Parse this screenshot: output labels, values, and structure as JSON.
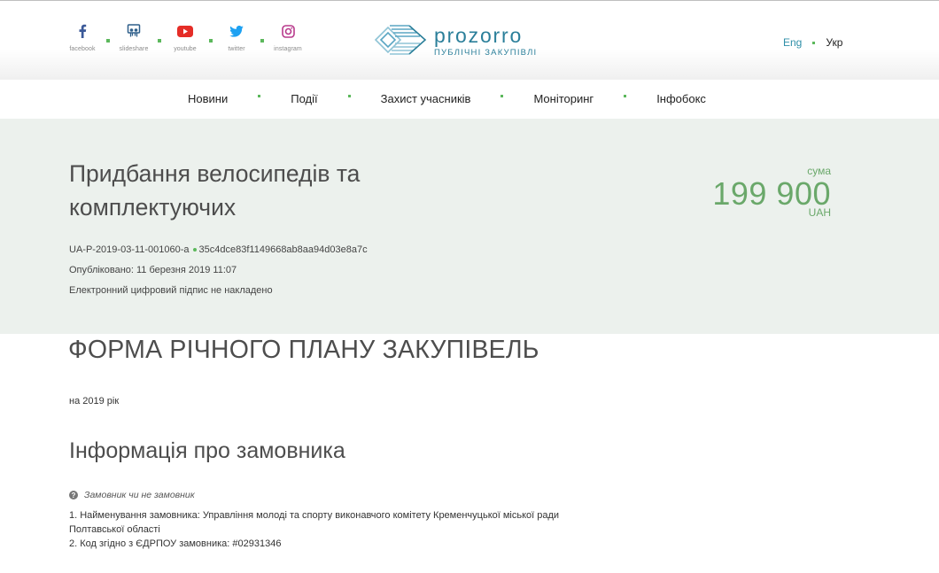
{
  "header": {
    "social": [
      {
        "icon": "facebook-icon",
        "label": "facebook",
        "color": "#3b5998"
      },
      {
        "icon": "slideshare-icon",
        "label": "slideshare",
        "color": "#2e5f8a"
      },
      {
        "icon": "youtube-icon",
        "label": "youtube",
        "color": "#e52d27"
      },
      {
        "icon": "twitter-icon",
        "label": "twitter",
        "color": "#1da1f2"
      },
      {
        "icon": "instagram-icon",
        "label": "instagram",
        "color": "#b83a8c"
      }
    ],
    "logo": {
      "name": "prozorro",
      "subtitle": "ПУБЛІЧНІ ЗАКУПІВЛІ"
    },
    "lang": {
      "en": "Eng",
      "uk": "Укр"
    }
  },
  "nav": {
    "items": [
      "Новини",
      "Події",
      "Захист учасників",
      "Моніторинг",
      "Інфобокс"
    ]
  },
  "plan": {
    "title": "Придбання велосипедів та комплектуючих",
    "plan_id": "UA-P-2019-03-11-001060-a",
    "hash": "35c4dce83f1149668ab8aa94d03e8a7c",
    "published": "Опубліковано: 11 березня 2019 11:07",
    "signature": "Електронний цифровий підпис не накладено",
    "sum_label": "сума",
    "sum_value": "199 900",
    "currency": "UAH"
  },
  "content": {
    "form_title": "ФОРМА РІЧНОГО ПЛАНУ ЗАКУПІВЕЛЬ",
    "year": "на 2019 рік",
    "info_title": "Інформація про замовника",
    "hint": "Замовник чи не замовник",
    "line1": "1. Найменування замовника: Управління молоді та спорту виконавчого комітету Кременчуцької міської ради",
    "line2": "Полтавської області",
    "line3": "2. Код згідно з ЄДРПОУ замовника: #02931346"
  },
  "colors": {
    "accent_green": "#5cb85c",
    "sum_green": "#6aa86a",
    "brand_blue": "#2b7f9a",
    "hero_bg": "#ecf1ed"
  }
}
